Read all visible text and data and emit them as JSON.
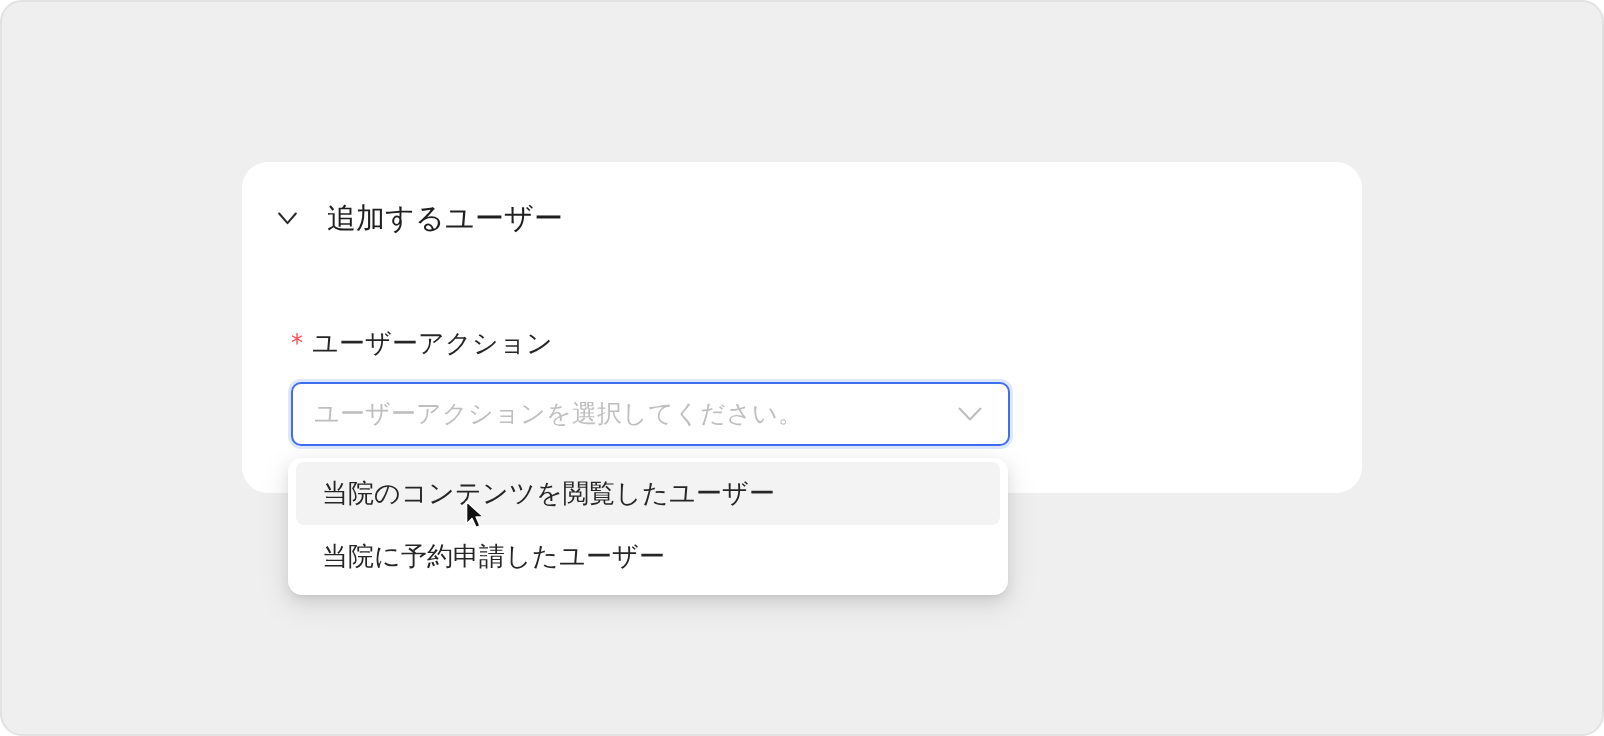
{
  "section": {
    "title": "追加するユーザー",
    "expanded": true
  },
  "field": {
    "required_mark": "*",
    "label": "ユーザーアクション",
    "placeholder": "ユーザーアクションを選択してください。",
    "focused": true
  },
  "menu": {
    "open": true,
    "items": [
      {
        "label": "当院のコンテンツを閲覧したユーザー",
        "highlighted": true,
        "selected": false
      },
      {
        "label": "当院に予約申請したユーザー",
        "highlighted": false,
        "selected": false
      }
    ]
  }
}
